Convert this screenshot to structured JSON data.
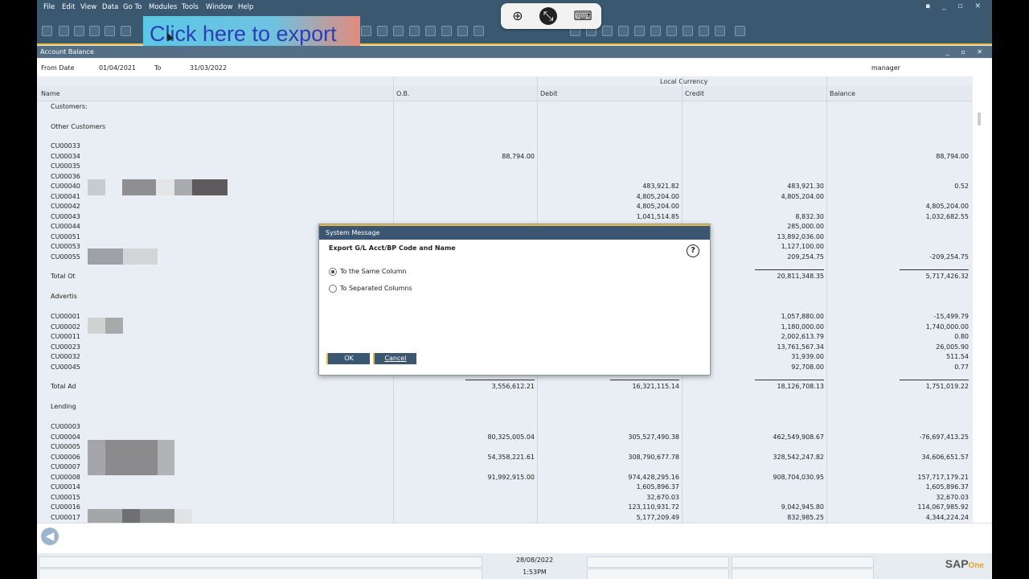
{
  "menu": [
    "File",
    "Edit",
    "View",
    "Data",
    "Go To",
    "Modules",
    "Tools",
    "Window",
    "Help"
  ],
  "overlay": {
    "export_hint": "Click here to export"
  },
  "window": {
    "title": "Account Balance"
  },
  "filters": {
    "from_label": "From Date",
    "from_value": "01/04/2021",
    "to_label": "To",
    "to_value": "31/03/2022",
    "user": "manager"
  },
  "grid": {
    "group_header": "Local Currency",
    "columns": [
      "Name",
      "O.B.",
      "Debit",
      "Credit",
      "Balance"
    ],
    "sections": {
      "customers": "Customers:",
      "other_customers": "Other Customers",
      "total_other": "Total Ot",
      "advertise": "Advertis",
      "total_adv": "Total Ad",
      "lending": "Lending"
    },
    "rows_a": [
      {
        "code": "CU00033",
        "ob": "",
        "debit": "",
        "credit": "",
        "balance": ""
      },
      {
        "code": "CU00034",
        "ob": "88,794.00",
        "debit": "",
        "credit": "",
        "balance": "88,794.00"
      },
      {
        "code": "CU00035",
        "ob": "",
        "debit": "",
        "credit": "",
        "balance": ""
      },
      {
        "code": "CU00036",
        "ob": "",
        "debit": "",
        "credit": "",
        "balance": ""
      },
      {
        "code": "CU00040",
        "ob": "",
        "debit": "483,921.82",
        "credit": "483,921.30",
        "balance": "0.52"
      },
      {
        "code": "CU00041",
        "ob": "",
        "debit": "4,805,204.00",
        "credit": "4,805,204.00",
        "balance": ""
      },
      {
        "code": "CU00042",
        "ob": "",
        "debit": "4,805,204.00",
        "credit": "",
        "balance": "4,805,204.00"
      },
      {
        "code": "CU00043",
        "ob": "",
        "debit": "1,041,514.85",
        "credit": "8,832.30",
        "balance": "1,032,682.55"
      },
      {
        "code": "CU00044",
        "ob": "",
        "debit": "",
        "credit": "285,000.00",
        "balance": ""
      },
      {
        "code": "CU00051",
        "ob": "",
        "debit": "",
        "credit": "13,892,036.00",
        "balance": ""
      },
      {
        "code": "CU00053",
        "ob": "",
        "debit": "",
        "credit": "1,127,100.00",
        "balance": ""
      },
      {
        "code": "CU00055",
        "ob": "",
        "debit": "",
        "credit": "209,254.75",
        "balance": "-209,254.75"
      }
    ],
    "total_other_values": {
      "credit": "20,811,348.35",
      "balance": "5,717,426.32"
    },
    "rows_b": [
      {
        "code": "CU00001",
        "credit": "1,057,880.00",
        "balance": "-15,499.79"
      },
      {
        "code": "CU00002",
        "credit": "1,180,000.00",
        "balance": "1,740,000.00"
      },
      {
        "code": "CU00011",
        "credit": "2,002,613.79",
        "balance": "0.80"
      },
      {
        "code": "CU00023",
        "credit": "13,761,567.34",
        "balance": "26,005.90"
      },
      {
        "code": "CU00032",
        "credit": "31,939.00",
        "balance": "511.54"
      },
      {
        "code": "CU00045",
        "credit": "92,708.00",
        "balance": "0.77"
      }
    ],
    "total_adv_values": {
      "ob": "3,556,612.21",
      "debit": "16,321,115.14",
      "credit": "18,126,708.13",
      "balance": "1,751,019.22"
    },
    "rows_c": [
      {
        "code": "CU00003",
        "ob": "",
        "debit": "",
        "credit": "",
        "balance": ""
      },
      {
        "code": "CU00004",
        "ob": "80,325,005.04",
        "debit": "305,527,490.38",
        "credit": "462,549,908.67",
        "balance": "-76,697,413.25"
      },
      {
        "code": "CU00005",
        "ob": "",
        "debit": "",
        "credit": "",
        "balance": ""
      },
      {
        "code": "CU00006",
        "ob": "54,358,221.61",
        "debit": "308,790,677.78",
        "credit": "328,542,247.82",
        "balance": "34,606,651.57"
      },
      {
        "code": "CU00007",
        "ob": "",
        "debit": "",
        "credit": "",
        "balance": ""
      },
      {
        "code": "CU00008",
        "ob": "91,992,915.00",
        "debit": "974,428,295.16",
        "credit": "908,704,030.95",
        "balance": "157,717,179.21"
      },
      {
        "code": "CU00014",
        "ob": "",
        "debit": "1,605,896.37",
        "credit": "",
        "balance": "1,605,896.37"
      },
      {
        "code": "CU00015",
        "ob": "",
        "debit": "32,670.03",
        "credit": "",
        "balance": "32,670.03"
      },
      {
        "code": "CU00016",
        "ob": "",
        "debit": "123,110,931.72",
        "credit": "9,042,945.80",
        "balance": "114,067,985.92"
      },
      {
        "code": "CU00017",
        "ob": "",
        "debit": "5,177,209.49",
        "credit": "832,985.25",
        "balance": "4,344,224.24"
      }
    ]
  },
  "dialog": {
    "title": "System Message",
    "heading": "Export G/L Acct/BP Code and Name",
    "option1": "To the Same Column",
    "option2": "To Separated Columns",
    "ok": "OK",
    "cancel": "Cancel"
  },
  "status": {
    "date": "28/08/2022",
    "time": "1:53PM",
    "brand": "SAP",
    "brand_sub": "One"
  }
}
